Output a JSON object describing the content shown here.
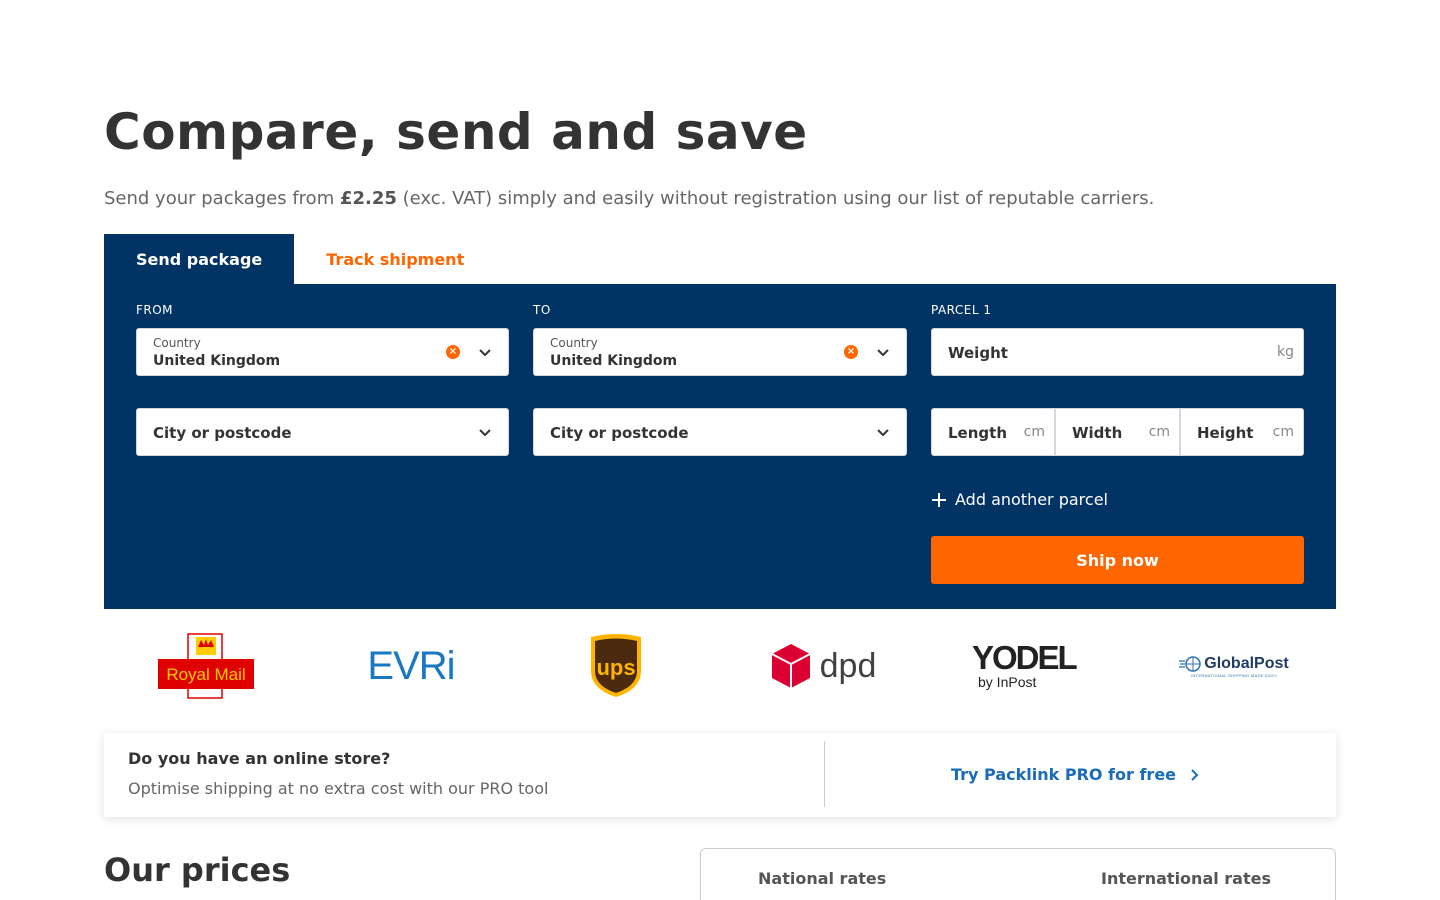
{
  "hero": {
    "title": "Compare, send and save",
    "subtitle_pre": "Send your packages from ",
    "subtitle_price": "£2.25",
    "subtitle_post": " (exc. VAT) simply and easily without registration using our list of reputable carriers."
  },
  "tabs": [
    {
      "label": "Send package",
      "active": true
    },
    {
      "label": "Track shipment",
      "active": false
    }
  ],
  "form": {
    "from": {
      "label": "FROM",
      "country_label": "Country",
      "country_value": "United Kingdom",
      "city_placeholder": "City or postcode"
    },
    "to": {
      "label": "TO",
      "country_label": "Country",
      "country_value": "United Kingdom",
      "city_placeholder": "City or postcode"
    },
    "parcel": {
      "label": "PARCEL 1",
      "weight_label": "Weight",
      "weight_unit": "kg",
      "length_label": "Length",
      "width_label": "Width",
      "height_label": "Height",
      "dim_unit": "cm"
    },
    "add_parcel": "Add another parcel",
    "ship_now": "Ship now"
  },
  "carriers": [
    {
      "name": "Royal Mail",
      "icon": "royal-mail-logo"
    },
    {
      "name": "EVRi",
      "icon": "evri-logo"
    },
    {
      "name": "ups",
      "icon": "ups-logo"
    },
    {
      "name": "dpd",
      "icon": "dpd-logo"
    },
    {
      "name": "YODEL",
      "sub": "by InPost",
      "icon": "yodel-logo"
    },
    {
      "name": "GlobalPost",
      "sub": "INTERNATIONAL SHIPPING MADE EASY",
      "icon": "globalpost-logo"
    }
  ],
  "pro": {
    "question": "Do you have an online store?",
    "description": "Optimise shipping at no extra cost with our PRO tool",
    "link": "Try Packlink PRO for free"
  },
  "prices": {
    "title": "Our prices",
    "tabs": [
      "National rates",
      "International rates"
    ]
  },
  "colors": {
    "navy": "#023365",
    "orange": "#ff6600",
    "link_blue": "#1a6bb8"
  }
}
